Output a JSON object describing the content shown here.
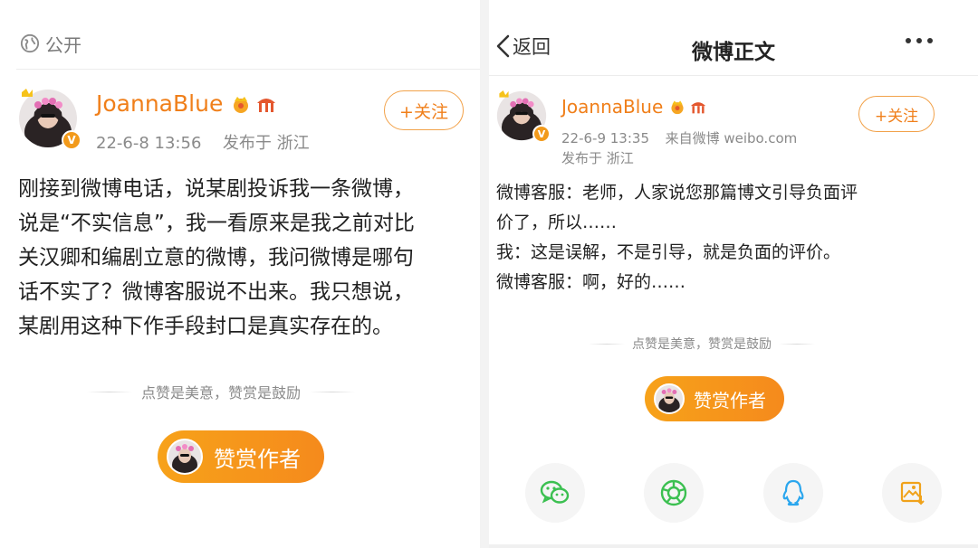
{
  "left": {
    "visibility_label": "公开",
    "username": "JoannaBlue",
    "date": "22-6-8 13:56",
    "location": "发布于 浙江",
    "follow_label": "+关注",
    "post_lines": [
      "刚接到微博电话，说某剧投诉我一条微博，",
      "说是“不实信息”，我一看原来是我之前对比",
      "关汉卿和编剧立意的微博，我问微博是哪句",
      "话不实了？微博客服说不出来。我只想说，",
      "某剧用这种下作手段封口是真实存在的。"
    ],
    "reward_hint": "点赞是美意，赞赏是鼓励",
    "reward_button": "赞赏作者"
  },
  "right": {
    "nav": {
      "back_label": "返回",
      "title": "微博正文"
    },
    "username": "JoannaBlue",
    "date": "22-6-9 13:35",
    "source": "来自微博 weibo.com",
    "location": "发布于 浙江",
    "follow_label": "+关注",
    "post_lines": [
      "微博客服：老师，人家说您那篇博文引导负面评",
      "价了，所以……",
      "我：这是误解，不是引导，就是负面的评价。",
      "微博客服：啊，好的……"
    ],
    "reward_hint": "点赞是美意，赞赏是鼓励",
    "reward_button": "赞赏作者",
    "share_icons": [
      "wechat-icon",
      "moments-icon",
      "qq-icon",
      "save-image-icon"
    ]
  },
  "colors": {
    "accent": "#f07f1a",
    "reward_gradient_start": "#f7a21a",
    "reward_gradient_end": "#f58a1c",
    "share_green": "#3cc051",
    "share_blue": "#2aa6ee"
  }
}
